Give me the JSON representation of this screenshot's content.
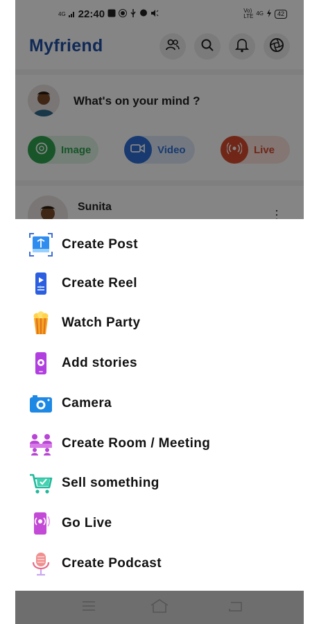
{
  "status_bar": {
    "time": "22:40",
    "net_left": "4G",
    "net_right_top": "Vo)",
    "net_right_bottom": "LTE",
    "net_right_4g": "4G",
    "battery": "42"
  },
  "header": {
    "app_name": "Myfriend"
  },
  "composer": {
    "prompt": "What's on your mind ?",
    "actions": [
      {
        "label": "Image",
        "color": "#2ea44f"
      },
      {
        "label": "Video",
        "color": "#2f6fd6"
      },
      {
        "label": "Live",
        "color": "#d64b2f"
      }
    ]
  },
  "feed": {
    "post_author": "Sunita"
  },
  "menu": {
    "items": [
      {
        "label": "Create Post",
        "icon": "create-post-icon"
      },
      {
        "label": "Create Reel",
        "icon": "create-reel-icon"
      },
      {
        "label": "Watch Party",
        "icon": "popcorn-icon"
      },
      {
        "label": "Add stories",
        "icon": "stories-icon"
      },
      {
        "label": "Camera",
        "icon": "camera-icon"
      },
      {
        "label": "Create Room / Meeting",
        "icon": "meeting-icon"
      },
      {
        "label": "Sell something",
        "icon": "cart-icon"
      },
      {
        "label": "Go Live",
        "icon": "live-icon"
      },
      {
        "label": "Create Podcast",
        "icon": "microphone-icon"
      }
    ]
  }
}
